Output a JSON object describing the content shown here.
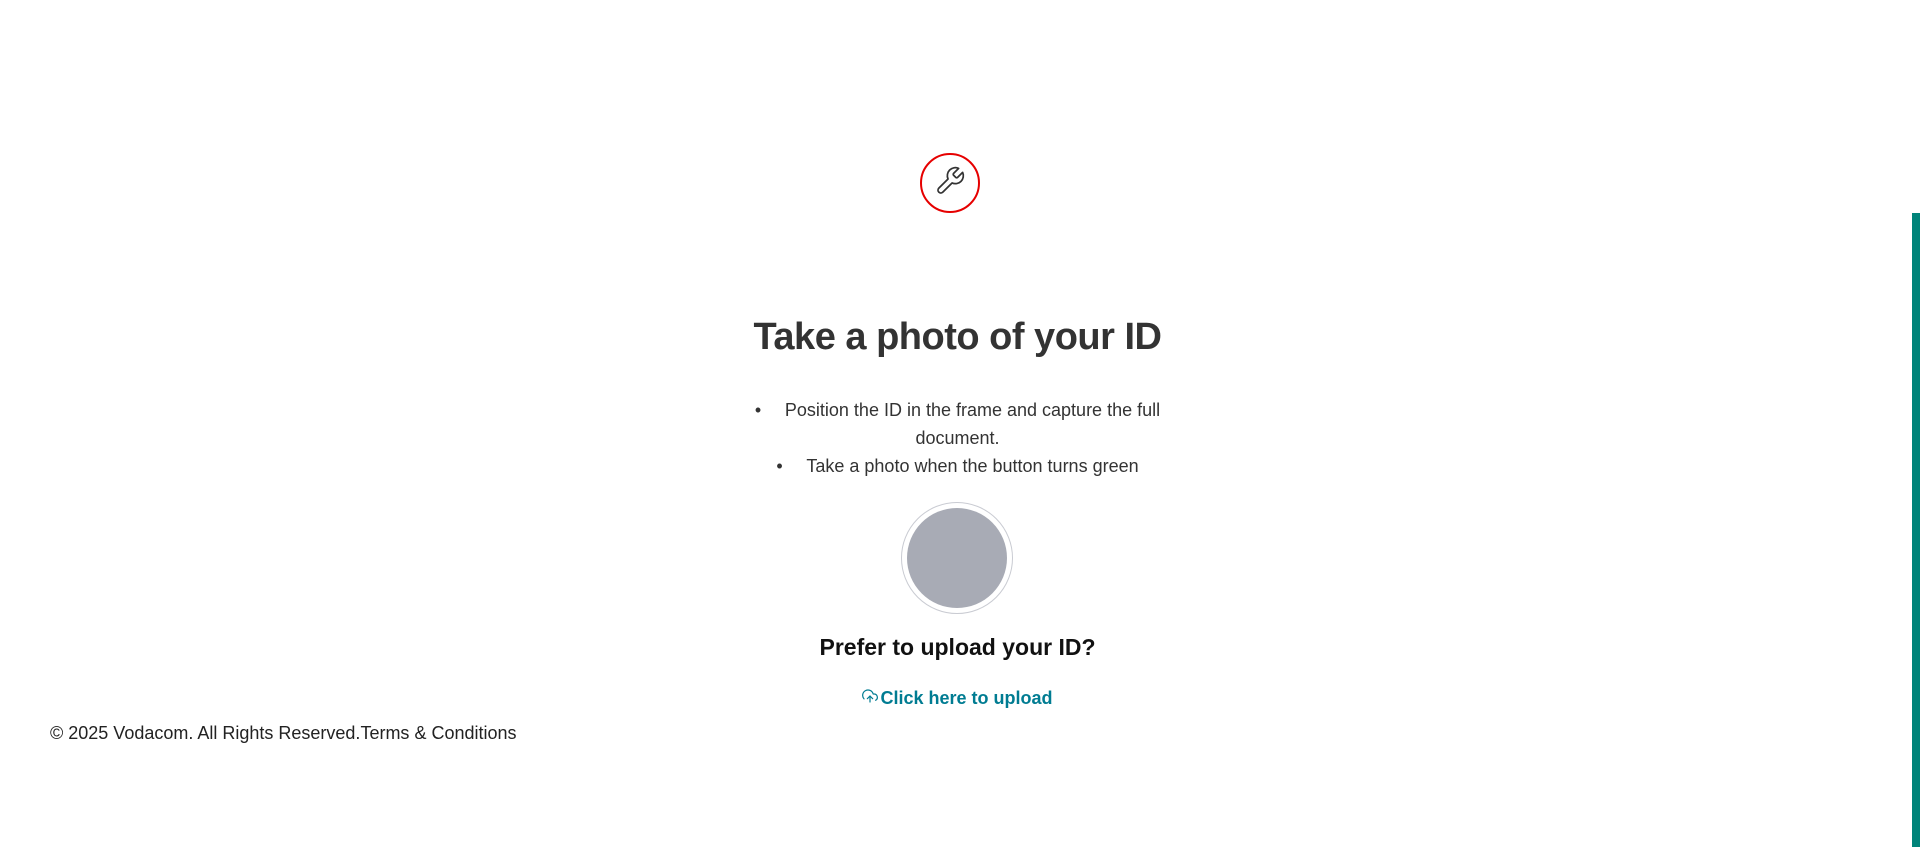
{
  "header": {
    "icon": "wrench-icon",
    "icon_color": "#e60000"
  },
  "main": {
    "title": "Take a photo of your ID",
    "instructions": [
      "Position the ID in the frame and capture the full document.",
      "Take a photo when the button turns green"
    ],
    "bullet": "•",
    "capture_button_color": "#a8abb5",
    "upload_heading": "Prefer to upload your ID?",
    "upload_link": "Click here to upload",
    "upload_icon": "cloud-upload-icon",
    "link_color": "#007c92"
  },
  "footer": {
    "copyright": "© 2025 Vodacom. All Rights Reserved.",
    "terms_link": "Terms & Conditions"
  },
  "scrollbar": {
    "color": "#00847a"
  }
}
